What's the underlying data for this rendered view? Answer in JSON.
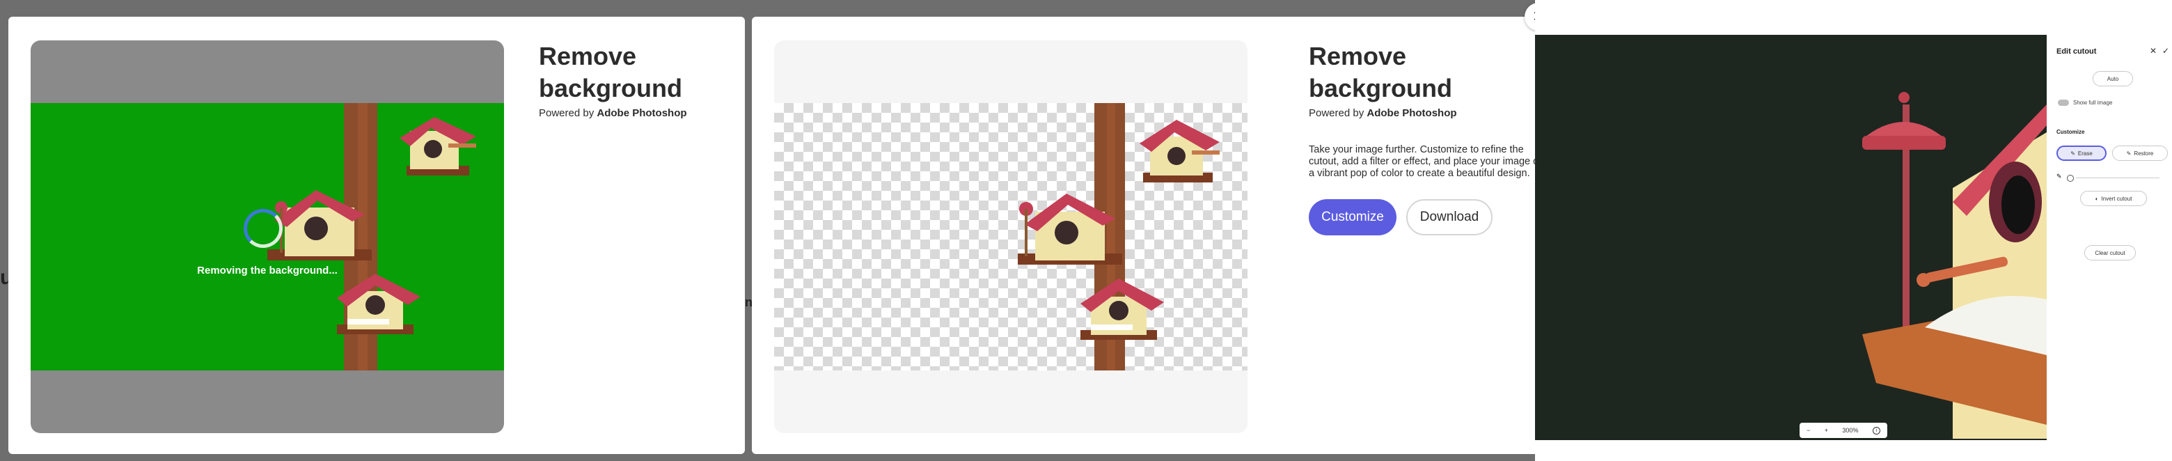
{
  "frame1": {
    "title": "Remove background",
    "powered_prefix": "Powered by",
    "powered_brand": "Adobe Photoshop",
    "loading_text": "Removing the background..."
  },
  "frame2": {
    "title": "Remove background",
    "powered_prefix": "Powered by",
    "powered_brand": "Adobe Photoshop",
    "description": "Take your image further. Customize to refine the cutout, add a filter or effect, and place your image on a vibrant pop of color to create a beautiful design.",
    "customize_label": "Customize",
    "download_label": "Download",
    "close_glyph": "✕"
  },
  "frame3": {
    "panel_title": "Edit cutout",
    "auto_label": "Auto",
    "show_full_image_label": "Show full image",
    "customize_heading": "Customize",
    "erase_label": "Erase",
    "restore_label": "Restore",
    "invert_cutout_label": "Invert cutout",
    "clear_cutout_label": "Clear cutout",
    "zoom_level": "300%",
    "close_glyph": "✕",
    "confirm_glyph": "✓",
    "zoom_out_glyph": "−",
    "zoom_in_glyph": "+"
  },
  "colors": {
    "accent": "#5c5ce0",
    "green_screen": "#079e07",
    "canvas_dark": "#1e2620"
  },
  "icons": [
    "close-icon",
    "check-icon",
    "spinner-icon",
    "zoom-in-icon",
    "zoom-out-icon",
    "info-icon",
    "brush-icon",
    "eraser-icon",
    "toggle-icon"
  ]
}
